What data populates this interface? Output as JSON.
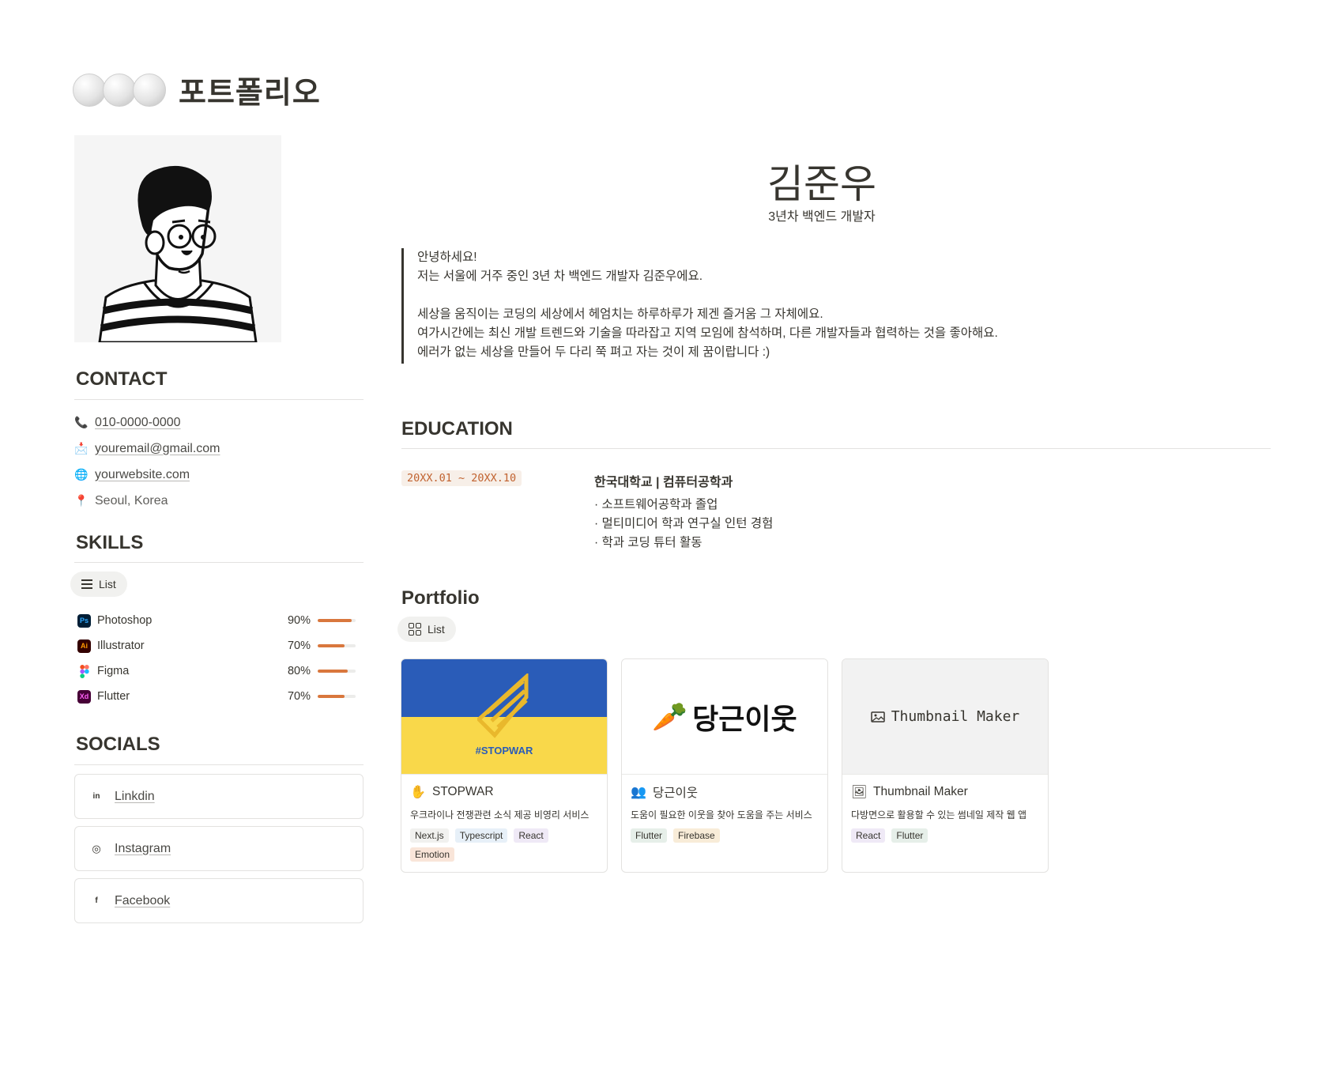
{
  "page": {
    "title": "포트폴리오"
  },
  "profile": {
    "name": "김준우",
    "role": "3년차 백엔드 개발자",
    "intro": [
      "안녕하세요!",
      "저는 서울에 거주 중인 3년 차 백엔드 개발자 김준우에요.",
      "",
      "세상을 움직이는 코딩의 세상에서 헤엄치는 하루하루가 제겐 즐거움 그 자체에요.",
      "여가시간에는 최신 개발 트렌드와 기술을 따라잡고 지역 모임에 참석하며, 다른 개발자들과 협력하는 것을 좋아해요.",
      "에러가 없는 세상을 만들어 두 다리 쭉 펴고 자는 것이 제 꿈이랍니다 :)"
    ]
  },
  "contact": {
    "heading": "CONTACT",
    "phone": "010-0000-0000",
    "email": "youremail@gmail.com",
    "website": "yourwebsite.com",
    "location": "Seoul, Korea"
  },
  "skills": {
    "heading": "SKILLS",
    "view_label": "List",
    "items": [
      {
        "name": "Photoshop",
        "badge": "Ps",
        "percent_label": "90%",
        "level": 0.9
      },
      {
        "name": "Illustrator",
        "badge": "Ai",
        "percent_label": "70%",
        "level": 0.7
      },
      {
        "name": "Figma",
        "badge": "",
        "percent_label": "80%",
        "level": 0.8
      },
      {
        "name": "Flutter",
        "badge": "Xd",
        "percent_label": "70%",
        "level": 0.7
      }
    ]
  },
  "socials": {
    "heading": "SOCIALS",
    "items": [
      {
        "label": "Linkdin",
        "icon": "in"
      },
      {
        "label": "Instagram",
        "icon": "◎"
      },
      {
        "label": "Facebook",
        "icon": "f"
      }
    ]
  },
  "education": {
    "heading": "EDUCATION",
    "date": "20XX.01 ~ 20XX.10",
    "school": "한국대학교 | 컴퓨터공학과",
    "points": [
      "· 소프트웨어공학과 졸업",
      "· 멀티미디어 학과 연구실 인턴 경험",
      "· 학과 코딩 튜터 활동"
    ]
  },
  "portfolio": {
    "heading": "Portfolio",
    "view_label": "List",
    "cards": [
      {
        "title": "STOPWAR",
        "cover_text": "#STOPWAR",
        "desc": "우크라이나 전쟁관련 소식 제공 비영리 서비스",
        "tags": [
          "Next.js",
          "Typescript",
          "React",
          "Emotion"
        ]
      },
      {
        "title": "당근이웃",
        "cover_text": "당근이웃",
        "desc": "도움이 필요한 이웃을 찾아 도움을 주는 서비스",
        "tags": [
          "Flutter",
          "Firebase"
        ]
      },
      {
        "title": "Thumbnail Maker",
        "cover_text": "Thumbnail Maker",
        "desc": "다방면으로 활용할 수 있는 썸네일 제작 웹 앱",
        "tags": [
          "React",
          "Flutter"
        ]
      }
    ]
  },
  "colors": {
    "accent": "#d9773d",
    "text": "#37352f",
    "ukraine_blue": "#2a5cb8",
    "ukraine_yellow": "#f9d84a"
  }
}
